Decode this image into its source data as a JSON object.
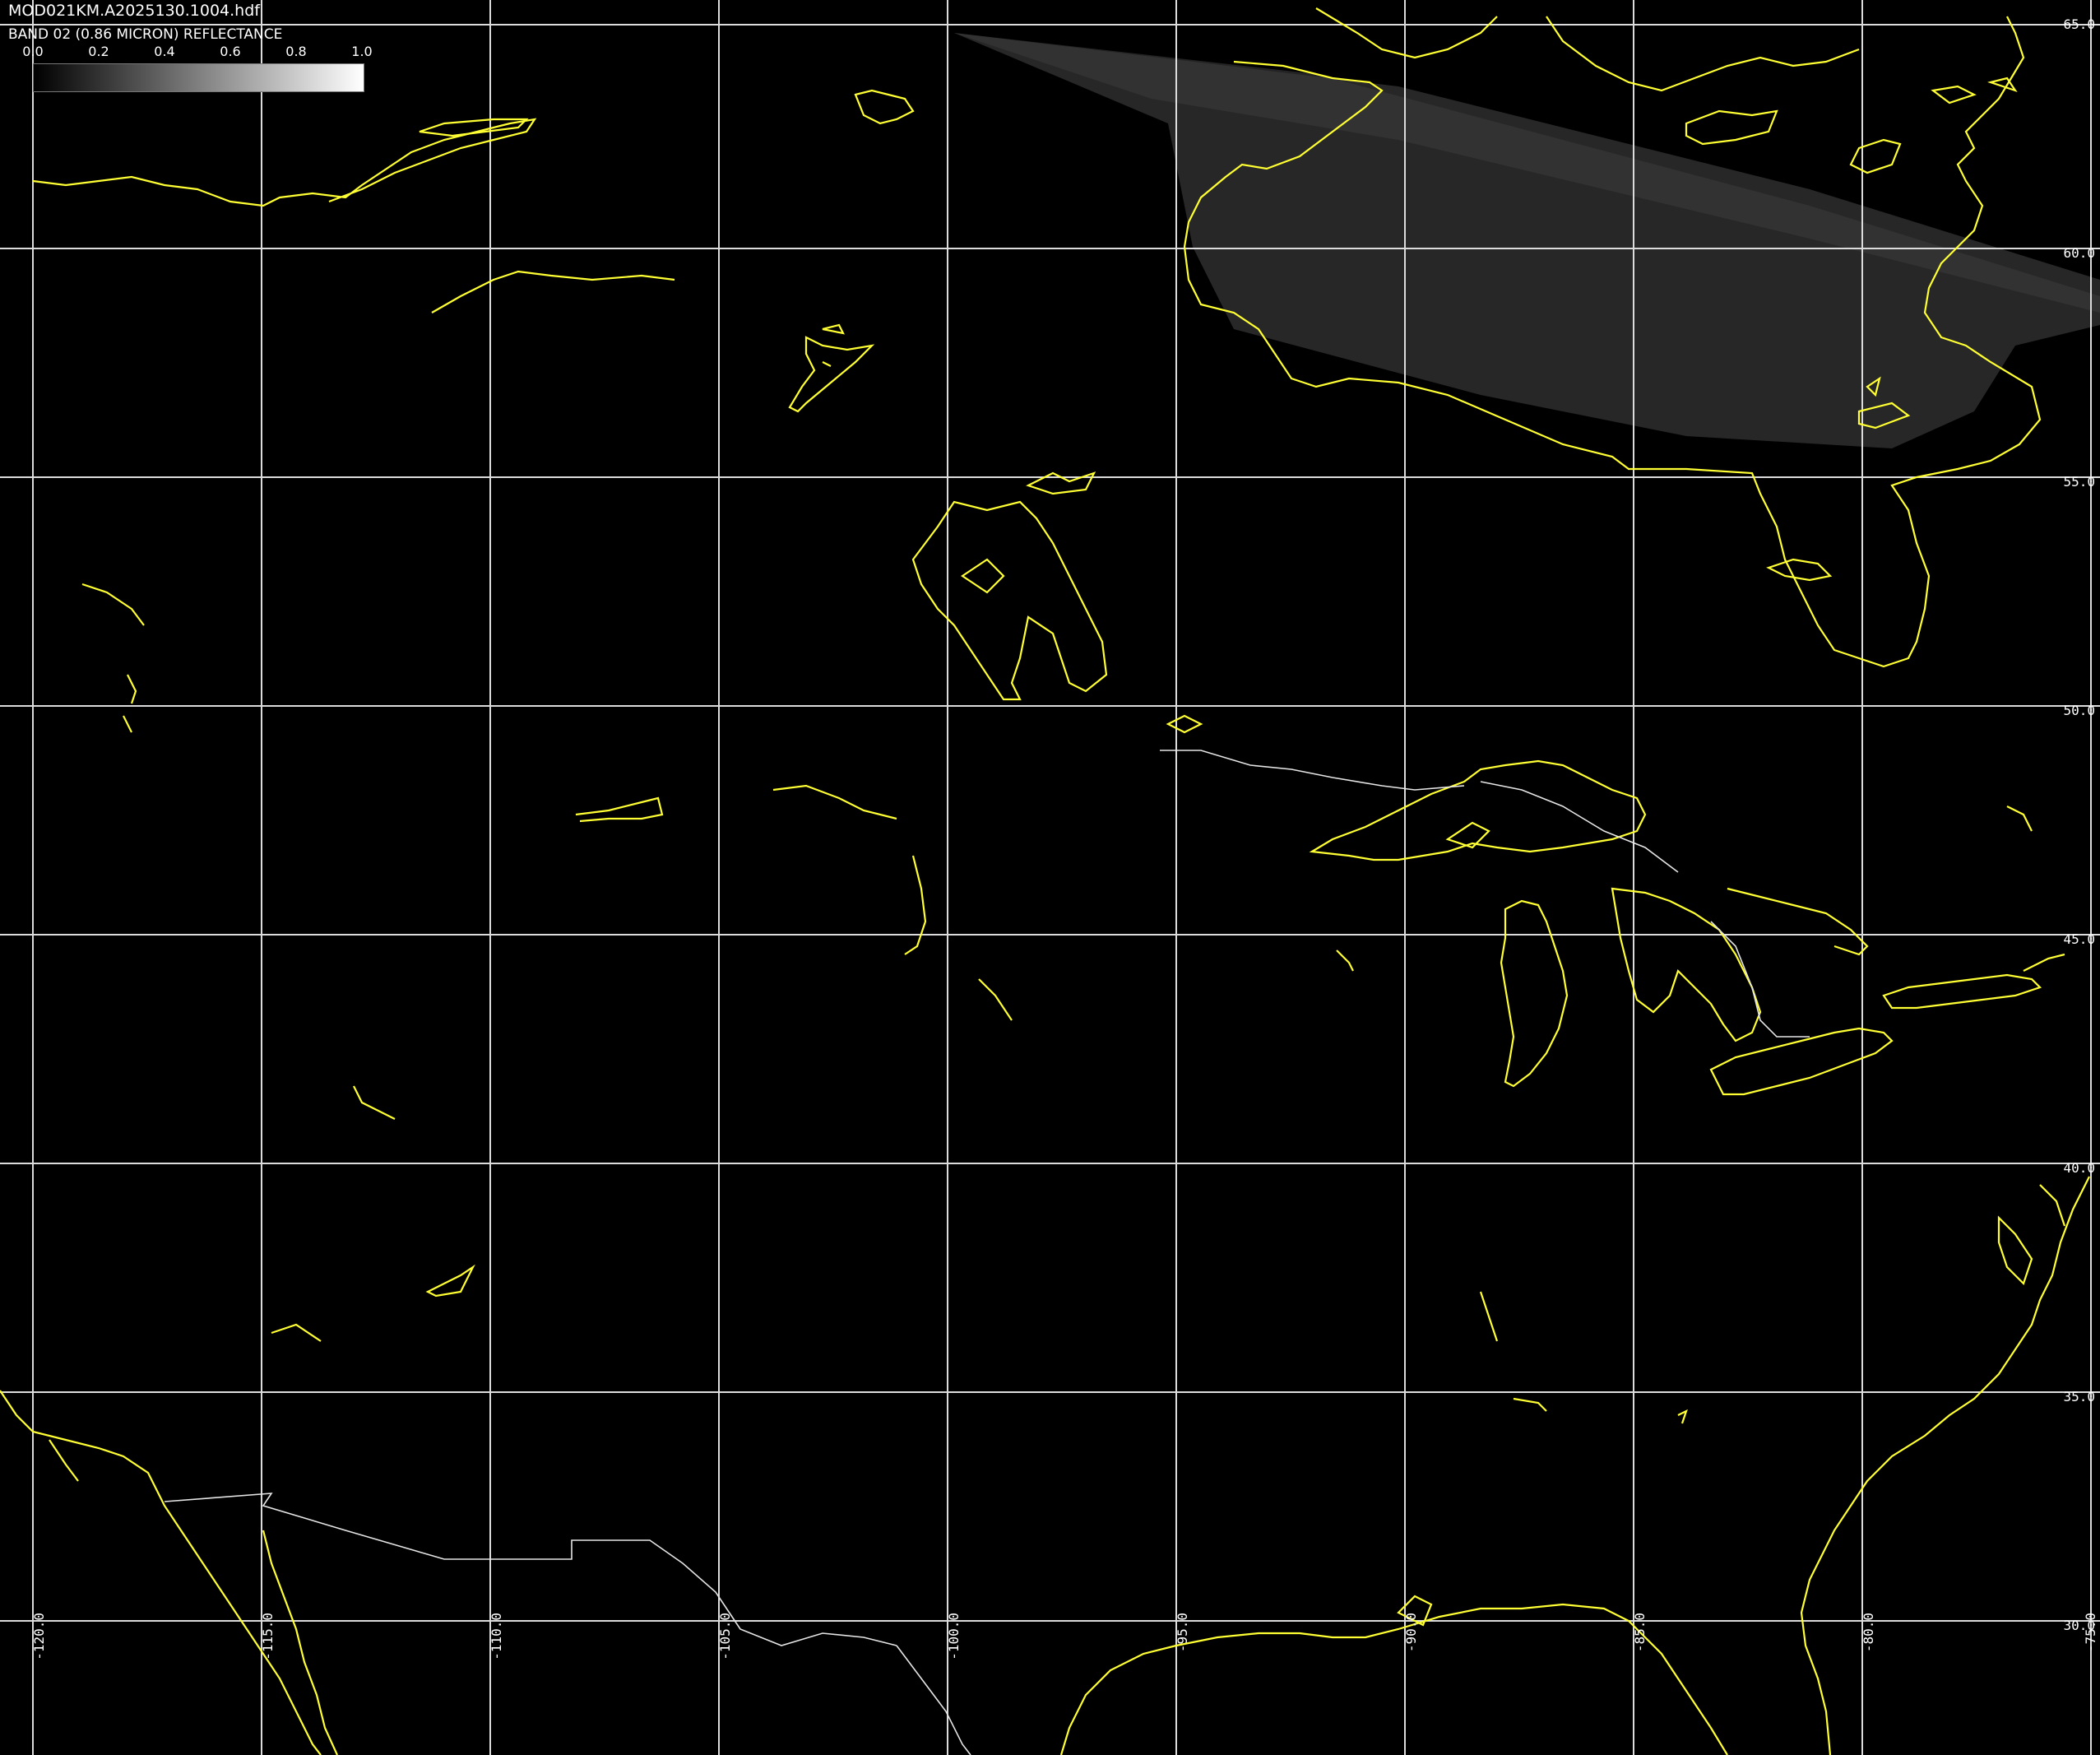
{
  "header": {
    "filename": "MOD021KM.A2025130.1004.hdf",
    "band_title": "BAND 02 (0.86 MICRON) REFLECTANCE"
  },
  "colorbar": {
    "ticks": [
      "0.0",
      "0.2",
      "0.4",
      "0.6",
      "0.8",
      "1.0"
    ],
    "start_color": "#000000",
    "end_color": "#ffffff"
  },
  "grid": {
    "latitudes": [
      "65.0",
      "60.0",
      "55.0",
      "50.0",
      "45.0",
      "40.0",
      "35.0",
      "30.0"
    ],
    "longitudes": [
      "-120.0",
      "-115.0",
      "-110.0",
      "-105.0",
      "-100.0",
      "-95.0",
      "-90.0",
      "-85.0",
      "-80.0",
      "-75.0"
    ]
  },
  "colors": {
    "background": "#000000",
    "gridline": "#ffffff",
    "coastline": "#ffff00",
    "border": "#ffffff"
  }
}
